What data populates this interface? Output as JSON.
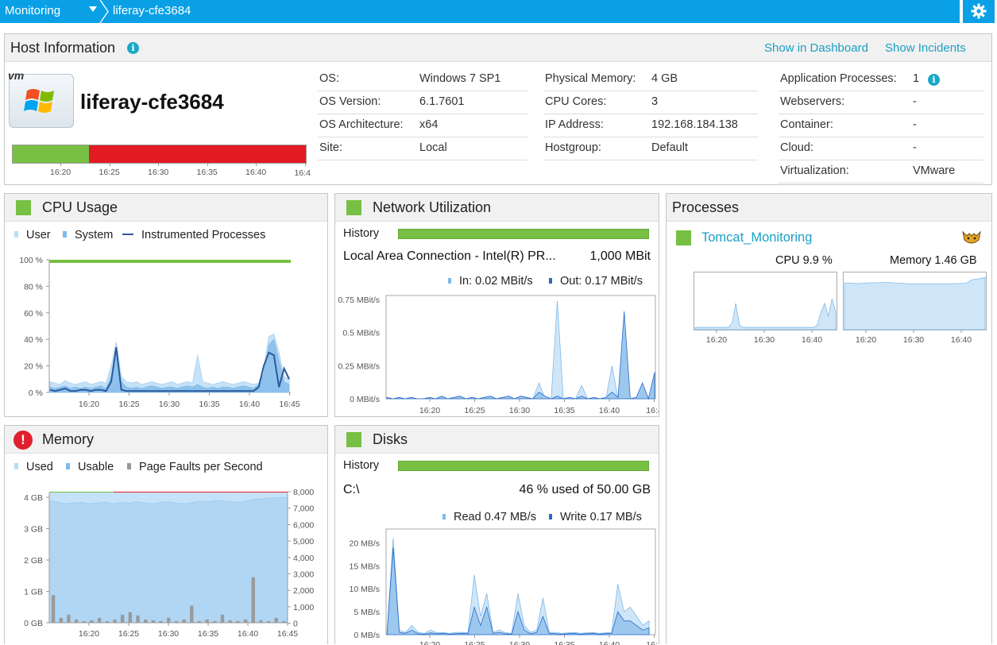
{
  "breadcrumb": {
    "root": "Monitoring",
    "current": "liferay-cfe3684"
  },
  "icons": {
    "settings": "gear-icon",
    "info": "info-icon",
    "alert": "alert-icon",
    "tomcat": "tomcat-icon",
    "vm": "vm-logo"
  },
  "colors": {
    "accent": "#0aa0e6",
    "ok": "#77c043",
    "bad": "#e02030",
    "link": "#1aa0c4",
    "series_light": "#b9dcf6",
    "series_mid": "#7fbaea",
    "series_dark": "#2a5a9a"
  },
  "host": {
    "section_title": "Host Information",
    "name": "liferay-cfe3684",
    "vm_logo": "vm",
    "show_dashboard": "Show in Dashboard",
    "show_incidents": "Show Incidents",
    "timeline_ticks": [
      "16:20",
      "16:25",
      "16:30",
      "16:35",
      "16:40",
      "16:4"
    ],
    "health_ok_fraction": 0.26,
    "col1": [
      {
        "label": "OS:",
        "value": "Windows 7 SP1"
      },
      {
        "label": "OS Version:",
        "value": "6.1.7601"
      },
      {
        "label": "OS Architecture:",
        "value": "x64"
      },
      {
        "label": "Site:",
        "value": "Local"
      }
    ],
    "col2": [
      {
        "label": "Physical Memory:",
        "value": "4 GB"
      },
      {
        "label": "CPU Cores:",
        "value": "3"
      },
      {
        "label": "IP Address:",
        "value": "192.168.184.138"
      },
      {
        "label": "Hostgroup:",
        "value": "Default"
      }
    ],
    "col3": [
      {
        "label": "Application Processes:",
        "value": "1"
      },
      {
        "label": "Webservers:",
        "value": "-"
      },
      {
        "label": "Container:",
        "value": "-"
      },
      {
        "label": "Cloud:",
        "value": "-"
      },
      {
        "label": "Virtualization:",
        "value": "VMware"
      }
    ]
  },
  "cpu": {
    "title": "CPU Usage",
    "legend": [
      "User",
      "System",
      "Instrumented Processes"
    ],
    "y_ticks": [
      "100 %",
      "80 %",
      "60 %",
      "40 %",
      "20 %",
      "0 %"
    ],
    "x_ticks": [
      "16:20",
      "16:25",
      "16:30",
      "16:35",
      "16:40",
      "16:45"
    ],
    "user": [
      8,
      7,
      6,
      9,
      7,
      6,
      7,
      8,
      6,
      7,
      8,
      7,
      20,
      38,
      12,
      8,
      7,
      8,
      6,
      7,
      8,
      7,
      6,
      7,
      8,
      6,
      7,
      8,
      7,
      28,
      8,
      7,
      6,
      7,
      8,
      7,
      6,
      7,
      8,
      7,
      6,
      7,
      18,
      42,
      44,
      30,
      12,
      10
    ],
    "system": [
      4,
      3,
      4,
      5,
      3,
      4,
      3,
      4,
      3,
      4,
      5,
      3,
      12,
      30,
      8,
      4,
      3,
      4,
      3,
      4,
      5,
      4,
      3,
      4,
      4,
      3,
      4,
      5,
      4,
      6,
      4,
      3,
      4,
      3,
      4,
      4,
      3,
      4,
      5,
      4,
      3,
      6,
      14,
      36,
      40,
      24,
      8,
      6
    ],
    "instrumented": [
      2,
      1,
      2,
      3,
      1,
      1,
      2,
      2,
      1,
      2,
      2,
      1,
      8,
      34,
      2,
      1,
      1,
      1,
      1,
      1,
      1,
      1,
      1,
      1,
      1,
      1,
      1,
      1,
      1,
      1,
      1,
      1,
      1,
      1,
      1,
      1,
      1,
      1,
      1,
      1,
      1,
      4,
      20,
      30,
      28,
      4,
      18,
      10
    ]
  },
  "network": {
    "title": "Network Utilization",
    "history_label": "History",
    "connection": "Local Area Connection - Intel(R) PR...",
    "speed": "1,000 MBit",
    "in_label": "In: 0.02 MBit/s",
    "out_label": "Out: 0.17 MBit/s",
    "y_ticks": [
      "0.75 MBit/s",
      "0.5 MBit/s",
      "0.25 MBit/s",
      "0 MBit/s"
    ],
    "x_ticks": [
      "16:20",
      "16:25",
      "16:30",
      "16:35",
      "16:40",
      "16:4"
    ],
    "in": [
      0,
      0,
      0,
      0,
      0,
      0,
      0,
      0,
      0,
      0,
      0,
      0,
      0,
      0,
      0,
      0,
      0,
      0.01,
      0,
      0,
      0,
      0,
      0.01,
      0,
      0,
      0.12,
      0,
      0,
      0.74,
      0,
      0,
      0,
      0.1,
      0,
      0,
      0,
      0,
      0.25,
      0,
      0,
      0,
      0,
      0,
      0,
      0.18
    ],
    "out": [
      0.01,
      0,
      0.01,
      0,
      0.01,
      0,
      0,
      0.01,
      0,
      0.02,
      0,
      0.01,
      0.02,
      0,
      0.01,
      0,
      0.01,
      0.02,
      0,
      0.01,
      0.02,
      0,
      0.02,
      0.01,
      0,
      0.05,
      0.02,
      0,
      0.02,
      0,
      0.01,
      0,
      0.02,
      0,
      0.01,
      0,
      0.01,
      0.05,
      0.01,
      0.66,
      0,
      0.01,
      0.12,
      0,
      0.2
    ]
  },
  "memory": {
    "title": "Memory",
    "legend": [
      "Used",
      "Usable",
      "Page Faults per Second"
    ],
    "y_ticks": [
      "4 GB",
      "3 GB",
      "2 GB",
      "1 GB",
      "0 GB"
    ],
    "y2_ticks": [
      "8,000",
      "7,000",
      "6,000",
      "5,000",
      "4,000",
      "3,000",
      "2,000",
      "1,000",
      "0"
    ],
    "x_ticks": [
      "16:20",
      "16:25",
      "16:30",
      "16:35",
      "16:40",
      "16:45"
    ],
    "health_ok_fraction": 0.27,
    "used": [
      3.8,
      3.75,
      3.7,
      3.72,
      3.74,
      3.7,
      3.72,
      3.75,
      3.7,
      3.74,
      3.72,
      3.76,
      3.72,
      3.7,
      3.74,
      3.76,
      3.72,
      3.7,
      3.74,
      3.78,
      3.76,
      3.8,
      3.78,
      3.76,
      3.74,
      3.8,
      3.84,
      3.86,
      3.88,
      3.9,
      3.88
    ],
    "page_faults": [
      1700,
      300,
      500,
      200,
      100,
      150,
      300,
      100,
      200,
      500,
      650,
      450,
      200,
      150,
      100,
      300,
      100,
      200,
      1050,
      100,
      200,
      100,
      500,
      150,
      100,
      200,
      2800,
      150,
      100,
      300,
      100
    ]
  },
  "disks": {
    "title": "Disks",
    "history_label": "History",
    "drive": "C:\\",
    "usage": "46 % used of 50.00 GB",
    "read_label": "Read 0.47 MB/s",
    "write_label": "Write 0.17 MB/s",
    "y_ticks": [
      "20 MB/s",
      "15 MB/s",
      "10 MB/s",
      "5 MB/s",
      "0 MB/s"
    ],
    "x_ticks": [
      "16:20",
      "16:25",
      "16:30",
      "16:35",
      "16:40",
      "16:4"
    ],
    "read": [
      0,
      21,
      1,
      0.5,
      2,
      0.5,
      0.3,
      1,
      0.4,
      0.5,
      0.3,
      0.5,
      0.5,
      0.4,
      13,
      4,
      9,
      0.5,
      1,
      0.4,
      0.3,
      9,
      2,
      0.5,
      1,
      8,
      0.5,
      0.5,
      0.3,
      0.4,
      0.5,
      0.3,
      0.4,
      0.5,
      0.3,
      0.4,
      0.5,
      11,
      5,
      6,
      4,
      2,
      3
    ],
    "write": [
      0,
      19,
      0.5,
      0.3,
      1,
      0.2,
      0.1,
      0.4,
      0.2,
      0.3,
      0.1,
      0.2,
      0.3,
      0.2,
      6,
      2,
      6,
      0.3,
      0.5,
      0.2,
      0.1,
      5,
      1,
      0.2,
      0.5,
      4,
      0.3,
      0.2,
      0.1,
      0.2,
      0.3,
      0.1,
      0.2,
      0.3,
      0.1,
      0.2,
      0.3,
      5,
      3,
      3,
      2,
      1,
      1.5
    ]
  },
  "processes": {
    "title": "Processes",
    "name": "Tomcat_Monitoring",
    "cpu_label": "CPU 9.9 %",
    "mem_label": "Memory 1.46 GB",
    "cpu_ticks": [
      "16:20",
      "16:30",
      "16:40"
    ],
    "mem_ticks": [
      "16:20",
      "16:30",
      "16:40"
    ],
    "cpu": [
      1,
      1,
      1,
      1,
      1,
      1,
      1,
      1,
      1,
      1,
      3,
      12,
      2,
      1,
      1,
      1,
      1,
      1,
      1,
      1,
      1,
      1,
      1,
      1,
      1,
      1,
      1,
      1,
      1,
      1,
      1,
      1,
      1,
      2,
      8,
      12,
      6,
      14,
      8
    ],
    "mem": [
      1.3,
      1.3,
      1.29,
      1.3,
      1.31,
      1.31,
      1.32,
      1.32,
      1.3,
      1.3,
      1.28,
      1.28,
      1.28,
      1.28,
      1.28,
      1.28,
      1.28,
      1.29,
      1.29,
      1.3,
      1.4,
      1.42,
      1.46
    ]
  }
}
